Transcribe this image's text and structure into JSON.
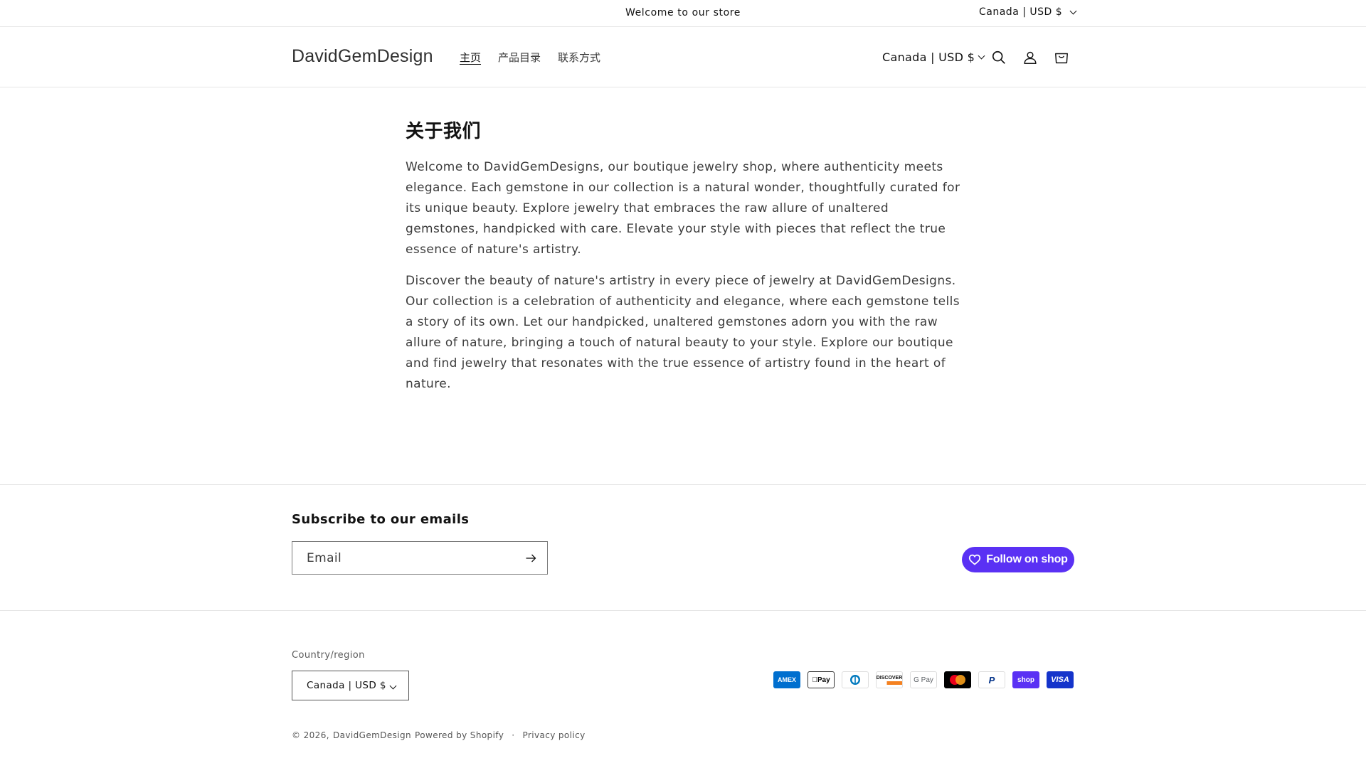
{
  "announcement": {
    "message": "Welcome to our store",
    "localization": "Canada | USD $"
  },
  "header": {
    "logo": "DavidGemDesign",
    "nav": [
      {
        "label": "主页",
        "active": true
      },
      {
        "label": "产品目录",
        "active": false
      },
      {
        "label": "联系方式",
        "active": false
      }
    ],
    "localization": "Canada | USD $",
    "icons": [
      "search-icon",
      "account-icon",
      "cart-icon"
    ]
  },
  "main": {
    "title": "关于我们",
    "paragraphs": [
      "Welcome to DavidGemDesigns, our boutique jewelry shop, where authenticity meets elegance. Each gemstone in our collection is a natural wonder, thoughtfully curated for its unique beauty. Explore jewelry that embraces the raw allure of unaltered gemstones, handpicked with care. Elevate your style with pieces that reflect the true essence of nature's artistry.",
      "Discover the beauty of nature's artistry in every piece of jewelry at DavidGemDesigns. Our collection is a celebration of authenticity and elegance, where each gemstone tells a story of its own. Let our handpicked, unaltered gemstones adorn you with the raw allure of nature, bringing a touch of natural beauty to your style. Explore our boutique and find jewelry that resonates with the true essence of artistry found in the heart of nature."
    ]
  },
  "footer": {
    "subscribe_title": "Subscribe to our emails",
    "email_placeholder": "Email",
    "follow_label": "Follow on shop",
    "follow_color": "#5a31f4",
    "country_label": "Country/region",
    "country_value": "Canada | USD $",
    "payments": [
      {
        "name": "AMEX",
        "icon": "amex-icon"
      },
      {
        "name": "Pay",
        "icon": "apple-pay-icon"
      },
      {
        "name": "Diners",
        "icon": "diners-club-icon"
      },
      {
        "name": "DISCOVER",
        "icon": "discover-icon"
      },
      {
        "name": "G Pay",
        "icon": "google-pay-icon"
      },
      {
        "name": "Mastercard",
        "icon": "mastercard-icon"
      },
      {
        "name": "PayPal",
        "icon": "paypal-icon"
      },
      {
        "name": "shop",
        "icon": "shop-pay-icon"
      },
      {
        "name": "VISA",
        "icon": "visa-icon"
      }
    ],
    "copyright": "© 2026,",
    "copyright_link": "DavidGemDesign",
    "powered_by": "Powered by Shopify",
    "privacy": "Privacy policy"
  }
}
